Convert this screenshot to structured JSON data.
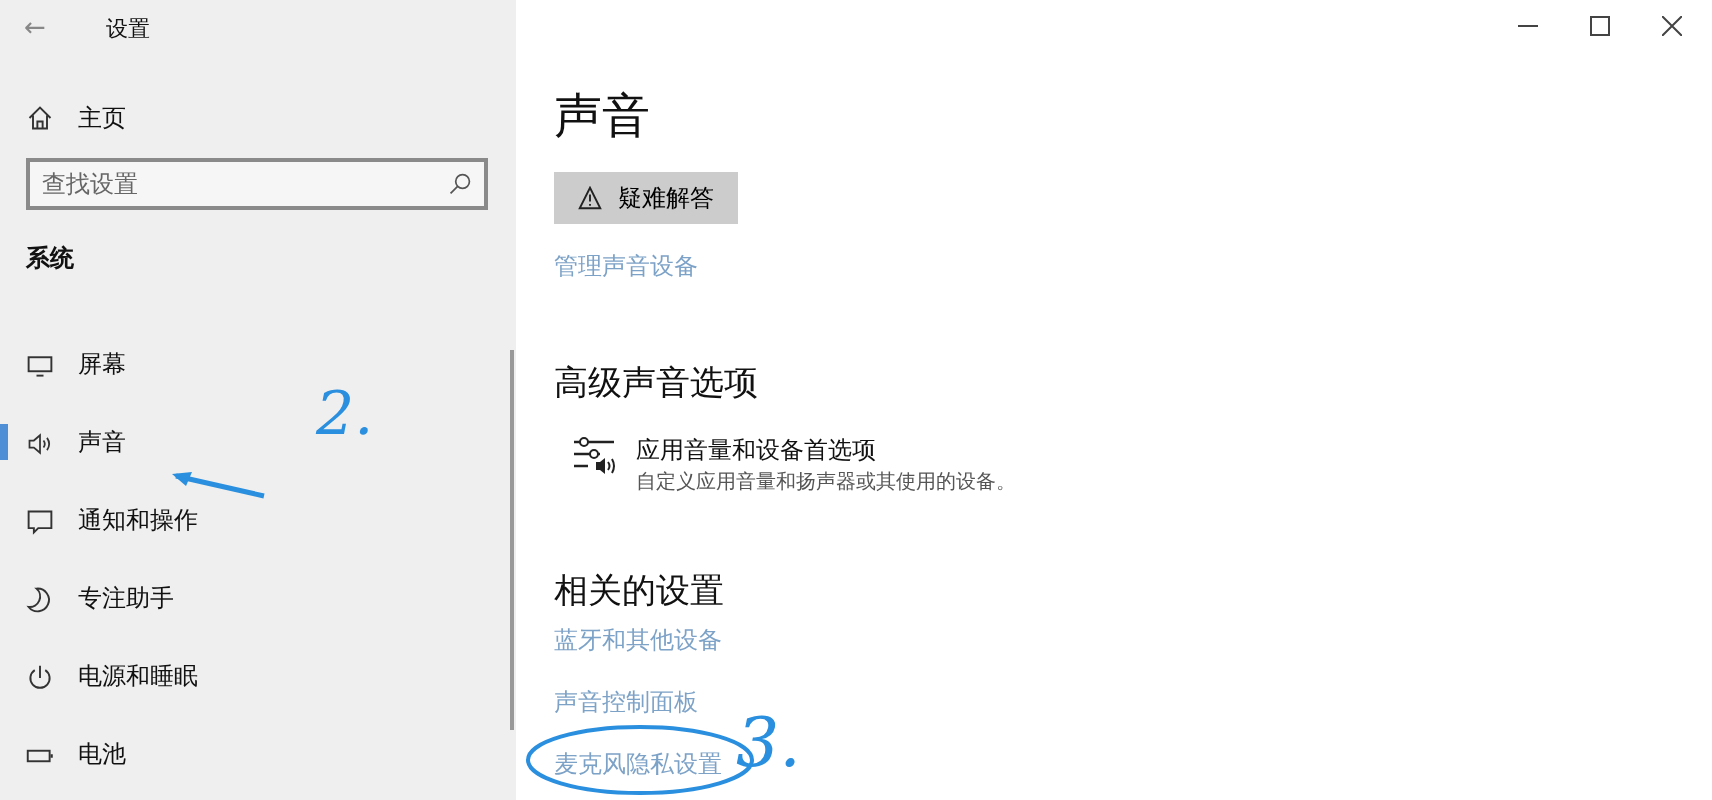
{
  "window": {
    "title": "设置",
    "back": "←"
  },
  "sidebar": {
    "home": "主页",
    "search": {
      "placeholder": "查找设置"
    },
    "section": "系统",
    "items": [
      {
        "label": "屏幕",
        "kind": "display",
        "selected": false
      },
      {
        "label": "声音",
        "kind": "speaker",
        "selected": true
      },
      {
        "label": "通知和操作",
        "kind": "message",
        "selected": false
      },
      {
        "label": "专注助手",
        "kind": "moon",
        "selected": false
      },
      {
        "label": "电源和睡眠",
        "kind": "power",
        "selected": false
      },
      {
        "label": "电池",
        "kind": "battery",
        "selected": false
      }
    ]
  },
  "page": {
    "title": "声音",
    "troubleshoot": "疑难解答",
    "manage_link": "管理声音设备",
    "advanced": {
      "heading": "高级声音选项",
      "option": {
        "title": "应用音量和设备首选项",
        "description": "自定义应用音量和扬声器或其使用的设备。"
      }
    },
    "related": {
      "heading": "相关的设置",
      "links": [
        "蓝牙和其他设备",
        "声音控制面板",
        "麦克风隐私设置"
      ]
    }
  },
  "annotations": [
    "2.",
    "3."
  ]
}
